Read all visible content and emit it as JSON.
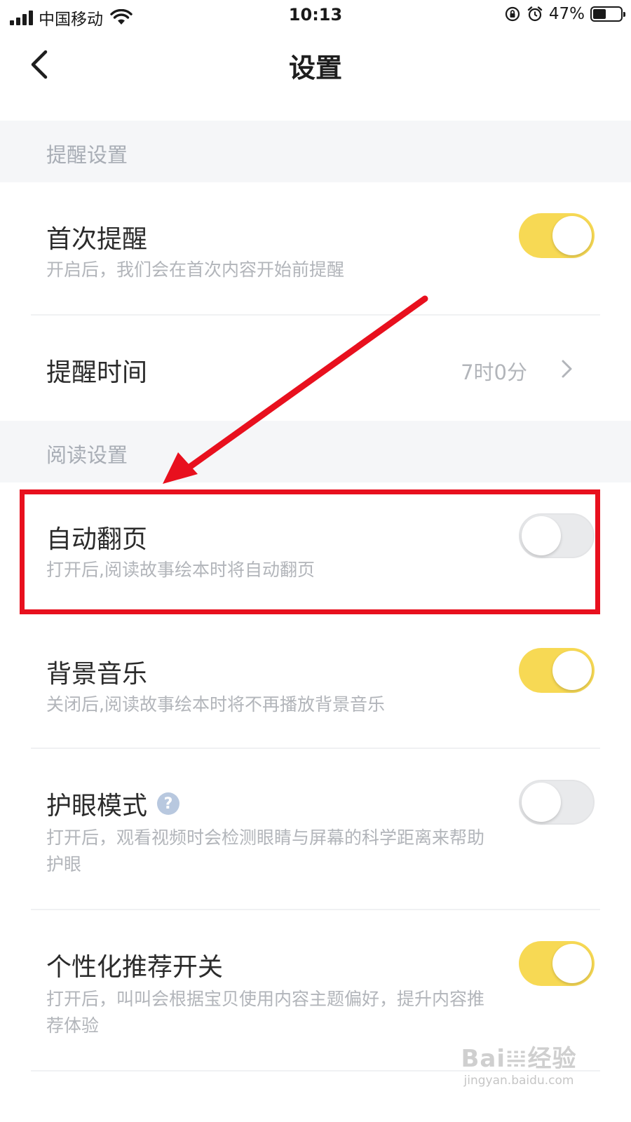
{
  "status_bar": {
    "carrier": "中国移动",
    "time": "10:13",
    "battery_percent": "47%",
    "battery_level": 0.47
  },
  "nav": {
    "title": "设置"
  },
  "sections": {
    "reminder": {
      "header": "提醒设置",
      "first_reminder": {
        "title": "首次提醒",
        "desc": "开启后，我们会在首次内容开始前提醒",
        "enabled": true
      },
      "reminder_time": {
        "title": "提醒时间",
        "value": "7时0分"
      }
    },
    "reading": {
      "header": "阅读设置",
      "auto_page": {
        "title": "自动翻页",
        "desc": "打开后,阅读故事绘本时将自动翻页",
        "enabled": false
      },
      "bg_music": {
        "title": "背景音乐",
        "desc": "关闭后,阅读故事绘本时将不再播放背景音乐",
        "enabled": true
      },
      "eye_care": {
        "title": "护眼模式",
        "desc": "打开后，观看视频时会检测眼睛与屏幕的科学距离来帮助护眼",
        "enabled": false,
        "help": "?"
      },
      "personalized": {
        "title": "个性化推荐开关",
        "desc": "打开后，叫叫会根据宝贝使用内容主题偏好，提升内容推荐体验",
        "enabled": true
      }
    }
  },
  "annotation": {
    "color": "#e8101e"
  },
  "watermark": {
    "logo": "Bai𝍐经验",
    "url": "jingyan.baidu.com"
  },
  "colors": {
    "toggle_on": "#f7d954",
    "toggle_off": "#e9eaec",
    "section_bg": "#f5f6f8"
  }
}
